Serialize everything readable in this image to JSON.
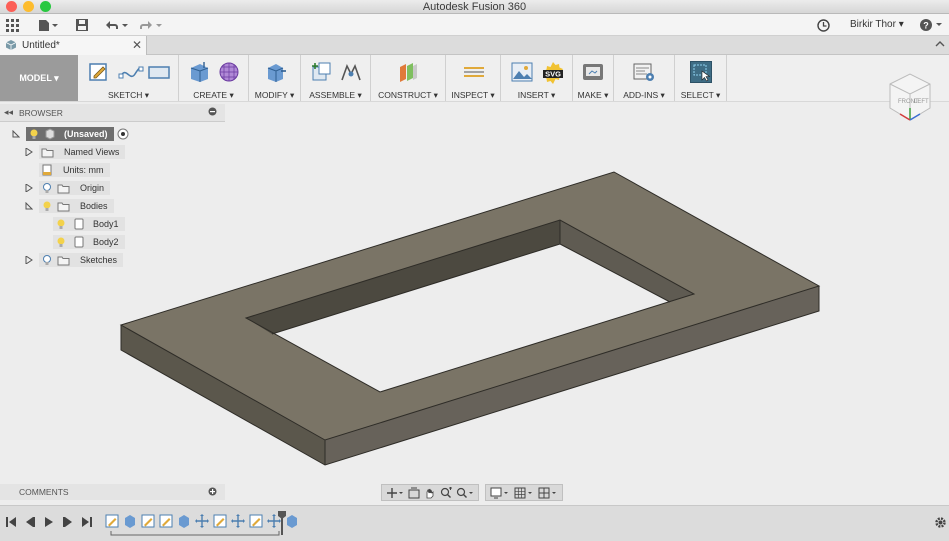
{
  "window": {
    "title": "Autodesk Fusion 360"
  },
  "appbar": {
    "user": "Birkir Thor ▾",
    "help": "?"
  },
  "tab": {
    "title": "Untitled*",
    "close": "✕"
  },
  "toolbar": {
    "workspace": "MODEL ▾",
    "groups": [
      {
        "label": "SKETCH ▾"
      },
      {
        "label": "CREATE ▾"
      },
      {
        "label": "MODIFY ▾"
      },
      {
        "label": "ASSEMBLE ▾"
      },
      {
        "label": "CONSTRUCT ▾"
      },
      {
        "label": "INSPECT ▾"
      },
      {
        "label": "INSERT ▾"
      },
      {
        "label": "MAKE ▾"
      },
      {
        "label": "ADD-INS ▾"
      },
      {
        "label": "SELECT ▾"
      }
    ],
    "svg_badge": "SVG"
  },
  "browser": {
    "title": "BROWSER",
    "items": [
      {
        "label": "(Unsaved)"
      },
      {
        "label": "Named Views"
      },
      {
        "label": "Units: mm"
      },
      {
        "label": "Origin"
      },
      {
        "label": "Bodies"
      },
      {
        "label": "Body1"
      },
      {
        "label": "Body2"
      },
      {
        "label": "Sketches"
      }
    ]
  },
  "comments": {
    "title": "COMMENTS"
  },
  "viewcube": {
    "front": "FRONT",
    "left": "LEFT"
  },
  "colors": {
    "model_top": "#7a7466",
    "model_side": "#5b574c",
    "selected_chip": "#6f6f6f"
  }
}
